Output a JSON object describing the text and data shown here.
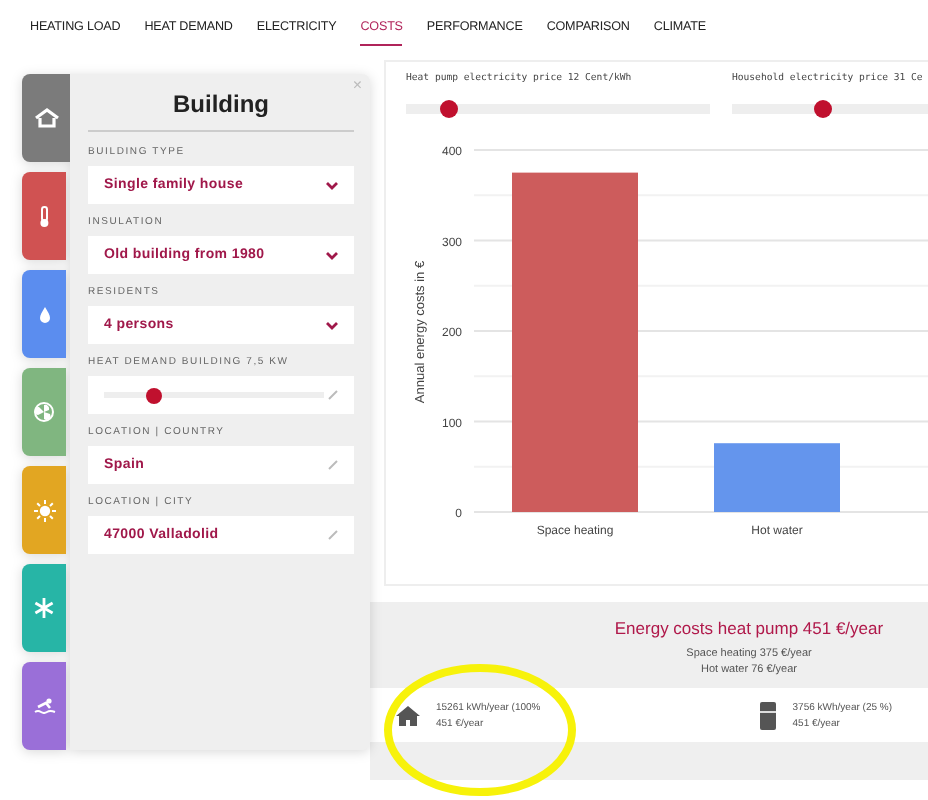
{
  "nav": [
    {
      "label": "HEATING LOAD",
      "selected": false
    },
    {
      "label": "HEAT DEMAND",
      "selected": false
    },
    {
      "label": "ELECTRICITY",
      "selected": false
    },
    {
      "label": "COSTS",
      "selected": true
    },
    {
      "label": "PERFORMANCE",
      "selected": false
    },
    {
      "label": "COMPARISON",
      "selected": false
    },
    {
      "label": "CLIMATE",
      "selected": false
    }
  ],
  "side_tabs": [
    {
      "kind": "house",
      "color": "#7b7b7b",
      "selected": true
    },
    {
      "kind": "thermometer",
      "color": "#d05252",
      "selected": false
    },
    {
      "kind": "drop",
      "color": "#5b8def",
      "selected": false
    },
    {
      "kind": "fan",
      "color": "#80b680",
      "selected": false
    },
    {
      "kind": "sun",
      "color": "#e2a622",
      "selected": false
    },
    {
      "kind": "snowflake",
      "color": "#27b5a6",
      "selected": false
    },
    {
      "kind": "pool",
      "color": "#9a6fd8",
      "selected": false
    }
  ],
  "panel": {
    "title": "Building",
    "close": "×",
    "fields": [
      {
        "kind": "select",
        "label": "BUILDING TYPE",
        "value": "Single family house"
      },
      {
        "kind": "select",
        "label": "INSULATION",
        "value": "Old building from 1980"
      },
      {
        "kind": "select",
        "label": "RESIDENTS",
        "value": "4 persons"
      },
      {
        "kind": "slider",
        "label": "HEAT DEMAND BUILDING 7,5 KW",
        "level": 0.23
      },
      {
        "kind": "text",
        "label": "LOCATION | COUNTRY",
        "value": "Spain"
      },
      {
        "kind": "text",
        "label": "LOCATION | CITY",
        "value": "47000 Valladolid"
      }
    ]
  },
  "prices": [
    {
      "label": "Heat pump electricity price 12 Cent/kWh",
      "level": 0.14
    },
    {
      "label": "Household electricity price 31 Ce",
      "level": 0.3
    }
  ],
  "chart_data": {
    "type": "bar",
    "ylabel": "Annual energy costs in €",
    "categories": [
      "Space heating",
      "Hot water"
    ],
    "values": [
      375,
      76
    ],
    "ylim": [
      0,
      400
    ],
    "grid": true,
    "yticks": [
      0,
      100,
      200,
      300,
      400
    ]
  },
  "summary": {
    "title": "Energy costs heat pump 451 €/year",
    "lines": [
      "Space heating 375 €/year",
      "Hot water 76 €/year"
    ],
    "items": [
      {
        "kind": "house",
        "lines": [
          "15261 kWh/year (100%",
          "451 €/year"
        ]
      },
      {
        "kind": "appliance",
        "lines": [
          "3756 kWh/year (25 %)",
          "451 €/year"
        ]
      }
    ]
  }
}
